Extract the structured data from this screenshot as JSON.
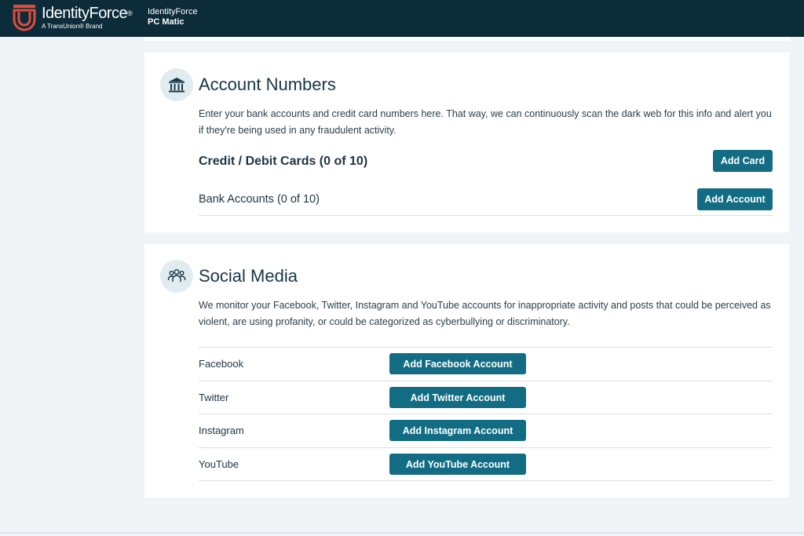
{
  "header": {
    "brand_name": "IdentityForce",
    "brand_reg": "®",
    "brand_tagline": "A TransUnion® Brand",
    "partner_line1": "IdentityForce",
    "partner_line2": "PC Matic",
    "bg_color": "#0c2c3a",
    "logo_color": "#e24c3b"
  },
  "accounts": {
    "icon": "bank-icon",
    "title": "Account Numbers",
    "description": "Enter your bank accounts and credit card numbers here. That way, we can continuously scan the dark web for this info and alert you if they're being used in any fraudulent activity.",
    "cards_label": "Credit / Debit Cards (0 of 10)",
    "add_card_label": "Add Card",
    "bank_label": "Bank Accounts (0 of 10)",
    "add_account_label": "Add Account"
  },
  "social": {
    "icon": "people-group-icon",
    "title": "Social Media",
    "description": "We monitor your Facebook, Twitter, Instagram and YouTube accounts for inappropriate activity and posts that could be perceived as violent, are using profanity, or could be categorized as cyberbullying or discriminatory.",
    "rows": [
      {
        "label": "Facebook",
        "button": "Add Facebook Account"
      },
      {
        "label": "Twitter",
        "button": "Add Twitter Account"
      },
      {
        "label": "Instagram",
        "button": "Add Instagram Account"
      },
      {
        "label": "YouTube",
        "button": "Add YouTube Account"
      }
    ]
  },
  "colors": {
    "button": "#126d84",
    "page_bg": "#f1f4f7",
    "icon_circle": "#e1ecf0"
  }
}
